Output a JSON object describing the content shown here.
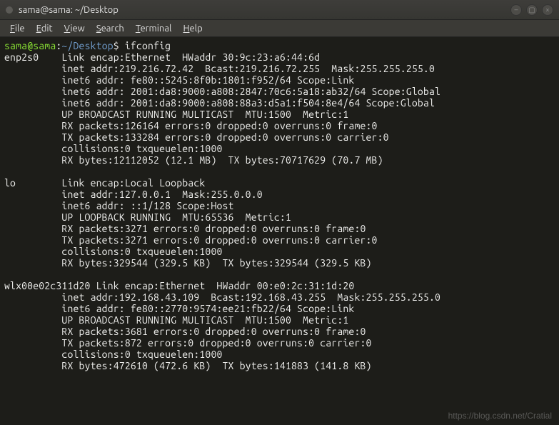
{
  "titlebar": {
    "title": "sama@sama: ~/Desktop"
  },
  "menubar": {
    "file": "File",
    "edit": "Edit",
    "view": "View",
    "search": "Search",
    "terminal": "Terminal",
    "help": "Help"
  },
  "prompt": {
    "userhost": "sama@sama",
    "sep": ":",
    "path": "~/Desktop",
    "dollar": "$",
    "cmd": "ifconfig"
  },
  "output_lines": [
    "enp2s0    Link encap:Ethernet  HWaddr 30:9c:23:a6:44:6d  ",
    "          inet addr:219.216.72.42  Bcast:219.216.72.255  Mask:255.255.255.0",
    "          inet6 addr: fe80::5245:8f0b:1801:f952/64 Scope:Link",
    "          inet6 addr: 2001:da8:9000:a808:2847:70c6:5a18:ab32/64 Scope:Global",
    "          inet6 addr: 2001:da8:9000:a808:88a3:d5a1:f504:8e4/64 Scope:Global",
    "          UP BROADCAST RUNNING MULTICAST  MTU:1500  Metric:1",
    "          RX packets:126164 errors:0 dropped:0 overruns:0 frame:0",
    "          TX packets:133284 errors:0 dropped:0 overruns:0 carrier:0",
    "          collisions:0 txqueuelen:1000 ",
    "          RX bytes:12112052 (12.1 MB)  TX bytes:70717629 (70.7 MB)",
    "",
    "lo        Link encap:Local Loopback  ",
    "          inet addr:127.0.0.1  Mask:255.0.0.0",
    "          inet6 addr: ::1/128 Scope:Host",
    "          UP LOOPBACK RUNNING  MTU:65536  Metric:1",
    "          RX packets:3271 errors:0 dropped:0 overruns:0 frame:0",
    "          TX packets:3271 errors:0 dropped:0 overruns:0 carrier:0",
    "          collisions:0 txqueuelen:1000 ",
    "          RX bytes:329544 (329.5 KB)  TX bytes:329544 (329.5 KB)",
    "",
    "wlx00e02c311d20 Link encap:Ethernet  HWaddr 00:e0:2c:31:1d:20  ",
    "          inet addr:192.168.43.109  Bcast:192.168.43.255  Mask:255.255.255.0",
    "          inet6 addr: fe80::2770:9574:ee21:fb22/64 Scope:Link",
    "          UP BROADCAST RUNNING MULTICAST  MTU:1500  Metric:1",
    "          RX packets:3681 errors:0 dropped:0 overruns:0 frame:0",
    "          TX packets:872 errors:0 dropped:0 overruns:0 carrier:0",
    "          collisions:0 txqueuelen:1000 ",
    "          RX bytes:472610 (472.6 KB)  TX bytes:141883 (141.8 KB)",
    ""
  ],
  "watermark": "https://blog.csdn.net/Cratial"
}
